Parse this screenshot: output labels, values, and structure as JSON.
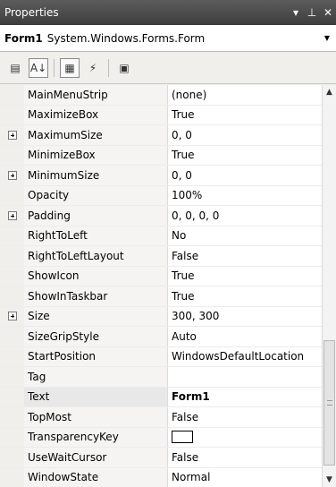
{
  "window": {
    "title": "Properties",
    "dropdown_icon": "triangle-down",
    "pin_icon": "pin",
    "close_icon": "close"
  },
  "object_selector": {
    "name": "Form1",
    "type": "System.Windows.Forms.Form"
  },
  "toolbar": {
    "buttons": [
      {
        "icon": "categorized-icon",
        "glyph": "▤",
        "active": false
      },
      {
        "icon": "alphabetical-icon",
        "glyph": "A↓",
        "active": true
      },
      {
        "icon": "properties-icon",
        "glyph": "▦",
        "active": true
      },
      {
        "icon": "events-icon",
        "glyph": "⚡",
        "active": false
      },
      {
        "icon": "property-pages-icon",
        "glyph": "▣",
        "active": false
      }
    ]
  },
  "properties": [
    {
      "name": "MainMenuStrip",
      "value": "(none)",
      "expandable": false
    },
    {
      "name": "MaximizeBox",
      "value": "True",
      "expandable": false
    },
    {
      "name": "MaximumSize",
      "value": "0, 0",
      "expandable": true
    },
    {
      "name": "MinimizeBox",
      "value": "True",
      "expandable": false
    },
    {
      "name": "MinimumSize",
      "value": "0, 0",
      "expandable": true
    },
    {
      "name": "Opacity",
      "value": "100%",
      "expandable": false
    },
    {
      "name": "Padding",
      "value": "0, 0, 0, 0",
      "expandable": true
    },
    {
      "name": "RightToLeft",
      "value": "No",
      "expandable": false
    },
    {
      "name": "RightToLeftLayout",
      "value": "False",
      "expandable": false
    },
    {
      "name": "ShowIcon",
      "value": "True",
      "expandable": false
    },
    {
      "name": "ShowInTaskbar",
      "value": "True",
      "expandable": false
    },
    {
      "name": "Size",
      "value": "300, 300",
      "expandable": true
    },
    {
      "name": "SizeGripStyle",
      "value": "Auto",
      "expandable": false
    },
    {
      "name": "StartPosition",
      "value": "WindowsDefaultLocation",
      "expandable": false
    },
    {
      "name": "Tag",
      "value": "",
      "expandable": false
    },
    {
      "name": "Text",
      "value": "Form1",
      "expandable": false,
      "bold": true,
      "selected": true
    },
    {
      "name": "TopMost",
      "value": "False",
      "expandable": false
    },
    {
      "name": "TransparencyKey",
      "value": "",
      "expandable": false,
      "swatch": "#ffffff"
    },
    {
      "name": "UseWaitCursor",
      "value": "False",
      "expandable": false
    },
    {
      "name": "WindowState",
      "value": "Normal",
      "expandable": false
    }
  ],
  "scrollbar": {
    "position_fraction": 0.72
  }
}
